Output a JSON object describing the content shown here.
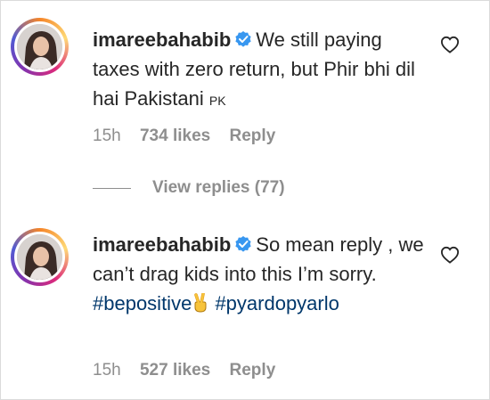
{
  "comments": [
    {
      "username": "imareebahabib",
      "text": "We still paying taxes with zero return, but Phir bhi dil hai Pakistani",
      "flag": "PK",
      "hashtags": [],
      "time": "15h",
      "likes": "734 likes",
      "reply": "Reply",
      "view_replies": "View replies (77)"
    },
    {
      "username": "imareebahabib",
      "text": "So mean reply , we can’t drag kids into this I’m sorry.",
      "hashtags": [
        "#bepositive",
        "#pyardopyarlo"
      ],
      "time": "15h",
      "likes": "527 likes",
      "reply": "Reply"
    }
  ],
  "colors": {
    "text": "#262626",
    "meta": "#8e8e8e",
    "verified": "#3897f0",
    "hashtag": "#00376b"
  },
  "icons": [
    "verified-badge-icon",
    "heart-icon",
    "victory-hand-icon",
    "avatar"
  ]
}
